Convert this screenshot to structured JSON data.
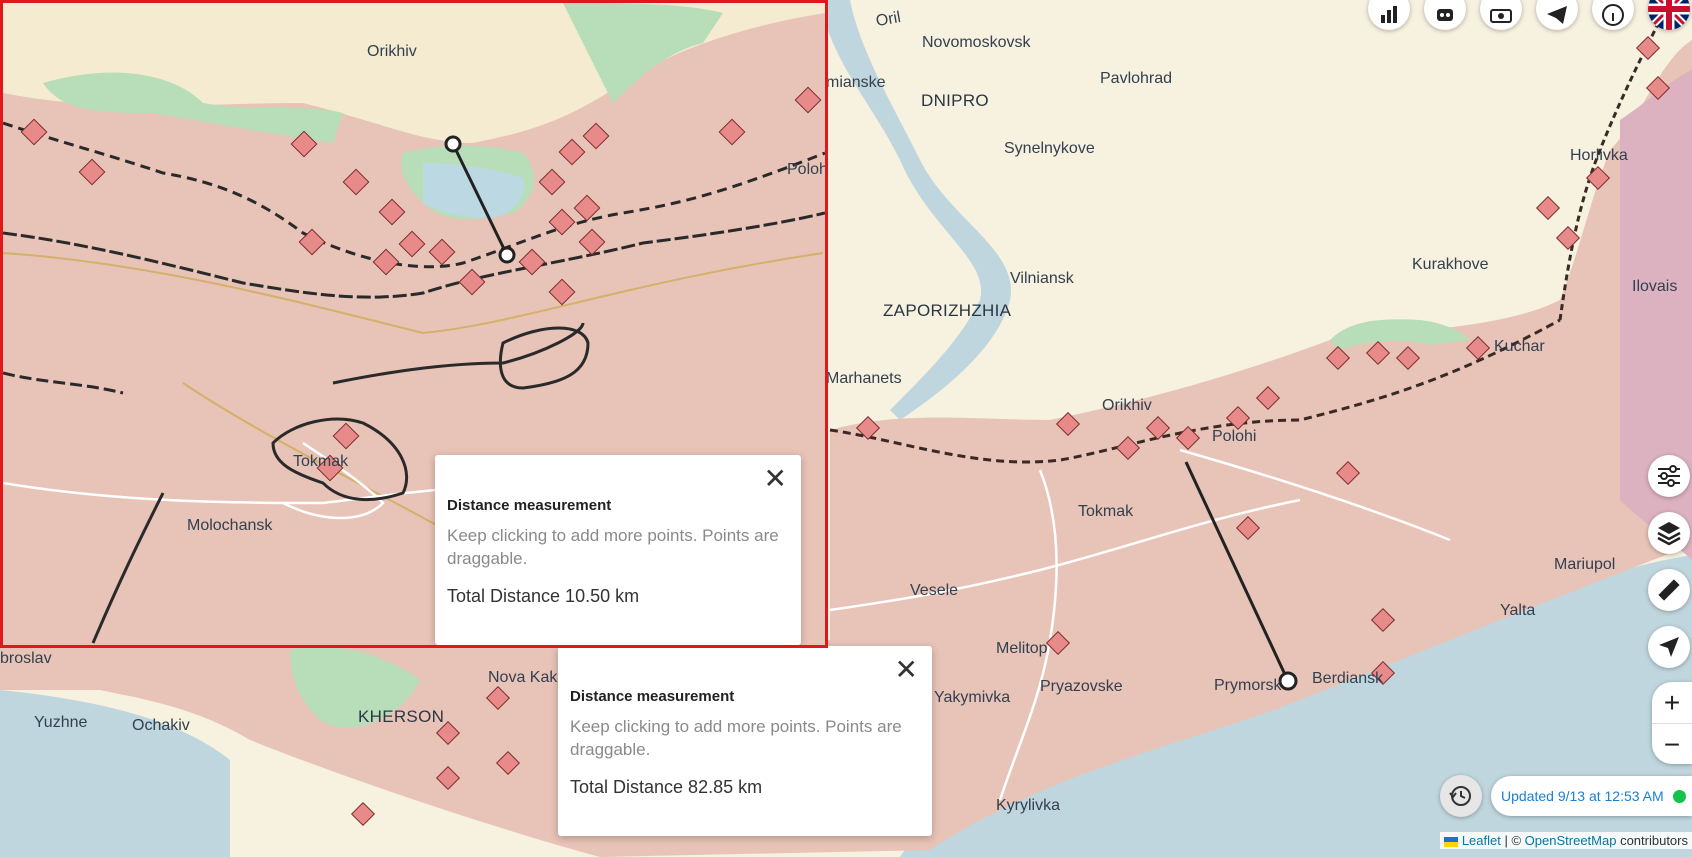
{
  "main_map": {
    "labels": [
      "Novomoskovsk",
      "Pavlohrad",
      "DNIPRO",
      "Synelnykove",
      "Vilniansk",
      "ZAPORIZHZHIA",
      "Kurakhove",
      "Marhanets",
      "Orikhiv",
      "Tokmak",
      "Vesele",
      "Melitop",
      "Pryazovske",
      "Yakymivka",
      "Prymorsk",
      "Berdiansk",
      "Mariupol",
      "Yalta",
      "KHERSON",
      "Nova Kak",
      "Yuzhne",
      "Ochakiv",
      "broslav",
      "Kyrylivka",
      "Horlivka",
      "Ilovais",
      "Kuchar",
      "Polohi",
      "Oril",
      "mianske"
    ],
    "measurement": {
      "title": "Distance measurement",
      "hint": "Keep clicking to add more points. Points are draggable.",
      "total": "Total Distance 82.85 km"
    }
  },
  "inset_map": {
    "labels": [
      "Orikhiv",
      "Tokmak",
      "Molochansk",
      "Poloh"
    ],
    "measurement": {
      "title": "Distance measurement",
      "hint": "Keep clicking to add more points. Points are draggable.",
      "total": "Total Distance 10.50 km"
    }
  },
  "controls": {
    "top_icons": [
      "bar-chart-icon",
      "robot-icon",
      "camera-icon",
      "telegram-icon",
      "info-icon",
      "uk-flag-icon"
    ],
    "right_icons": [
      "filters-icon",
      "layers-icon",
      "ruler-icon",
      "locate-icon"
    ],
    "zoom_in": "+",
    "zoom_out": "−",
    "history_icon": "history-icon",
    "updated": "Updated 9/13 at 12:53 AM",
    "status_color": "#13c34a"
  },
  "attribution": {
    "leaflet": "Leaflet",
    "separator": " | © ",
    "osm": "OpenStreetMap",
    "suffix": " contributors"
  },
  "colors": {
    "occupied": "#e8c3b7",
    "liberated": "#b7ddb9",
    "contested_fill": "#e88a8a",
    "sea": "#c0d6de",
    "ukraine": "#f7f1df"
  }
}
